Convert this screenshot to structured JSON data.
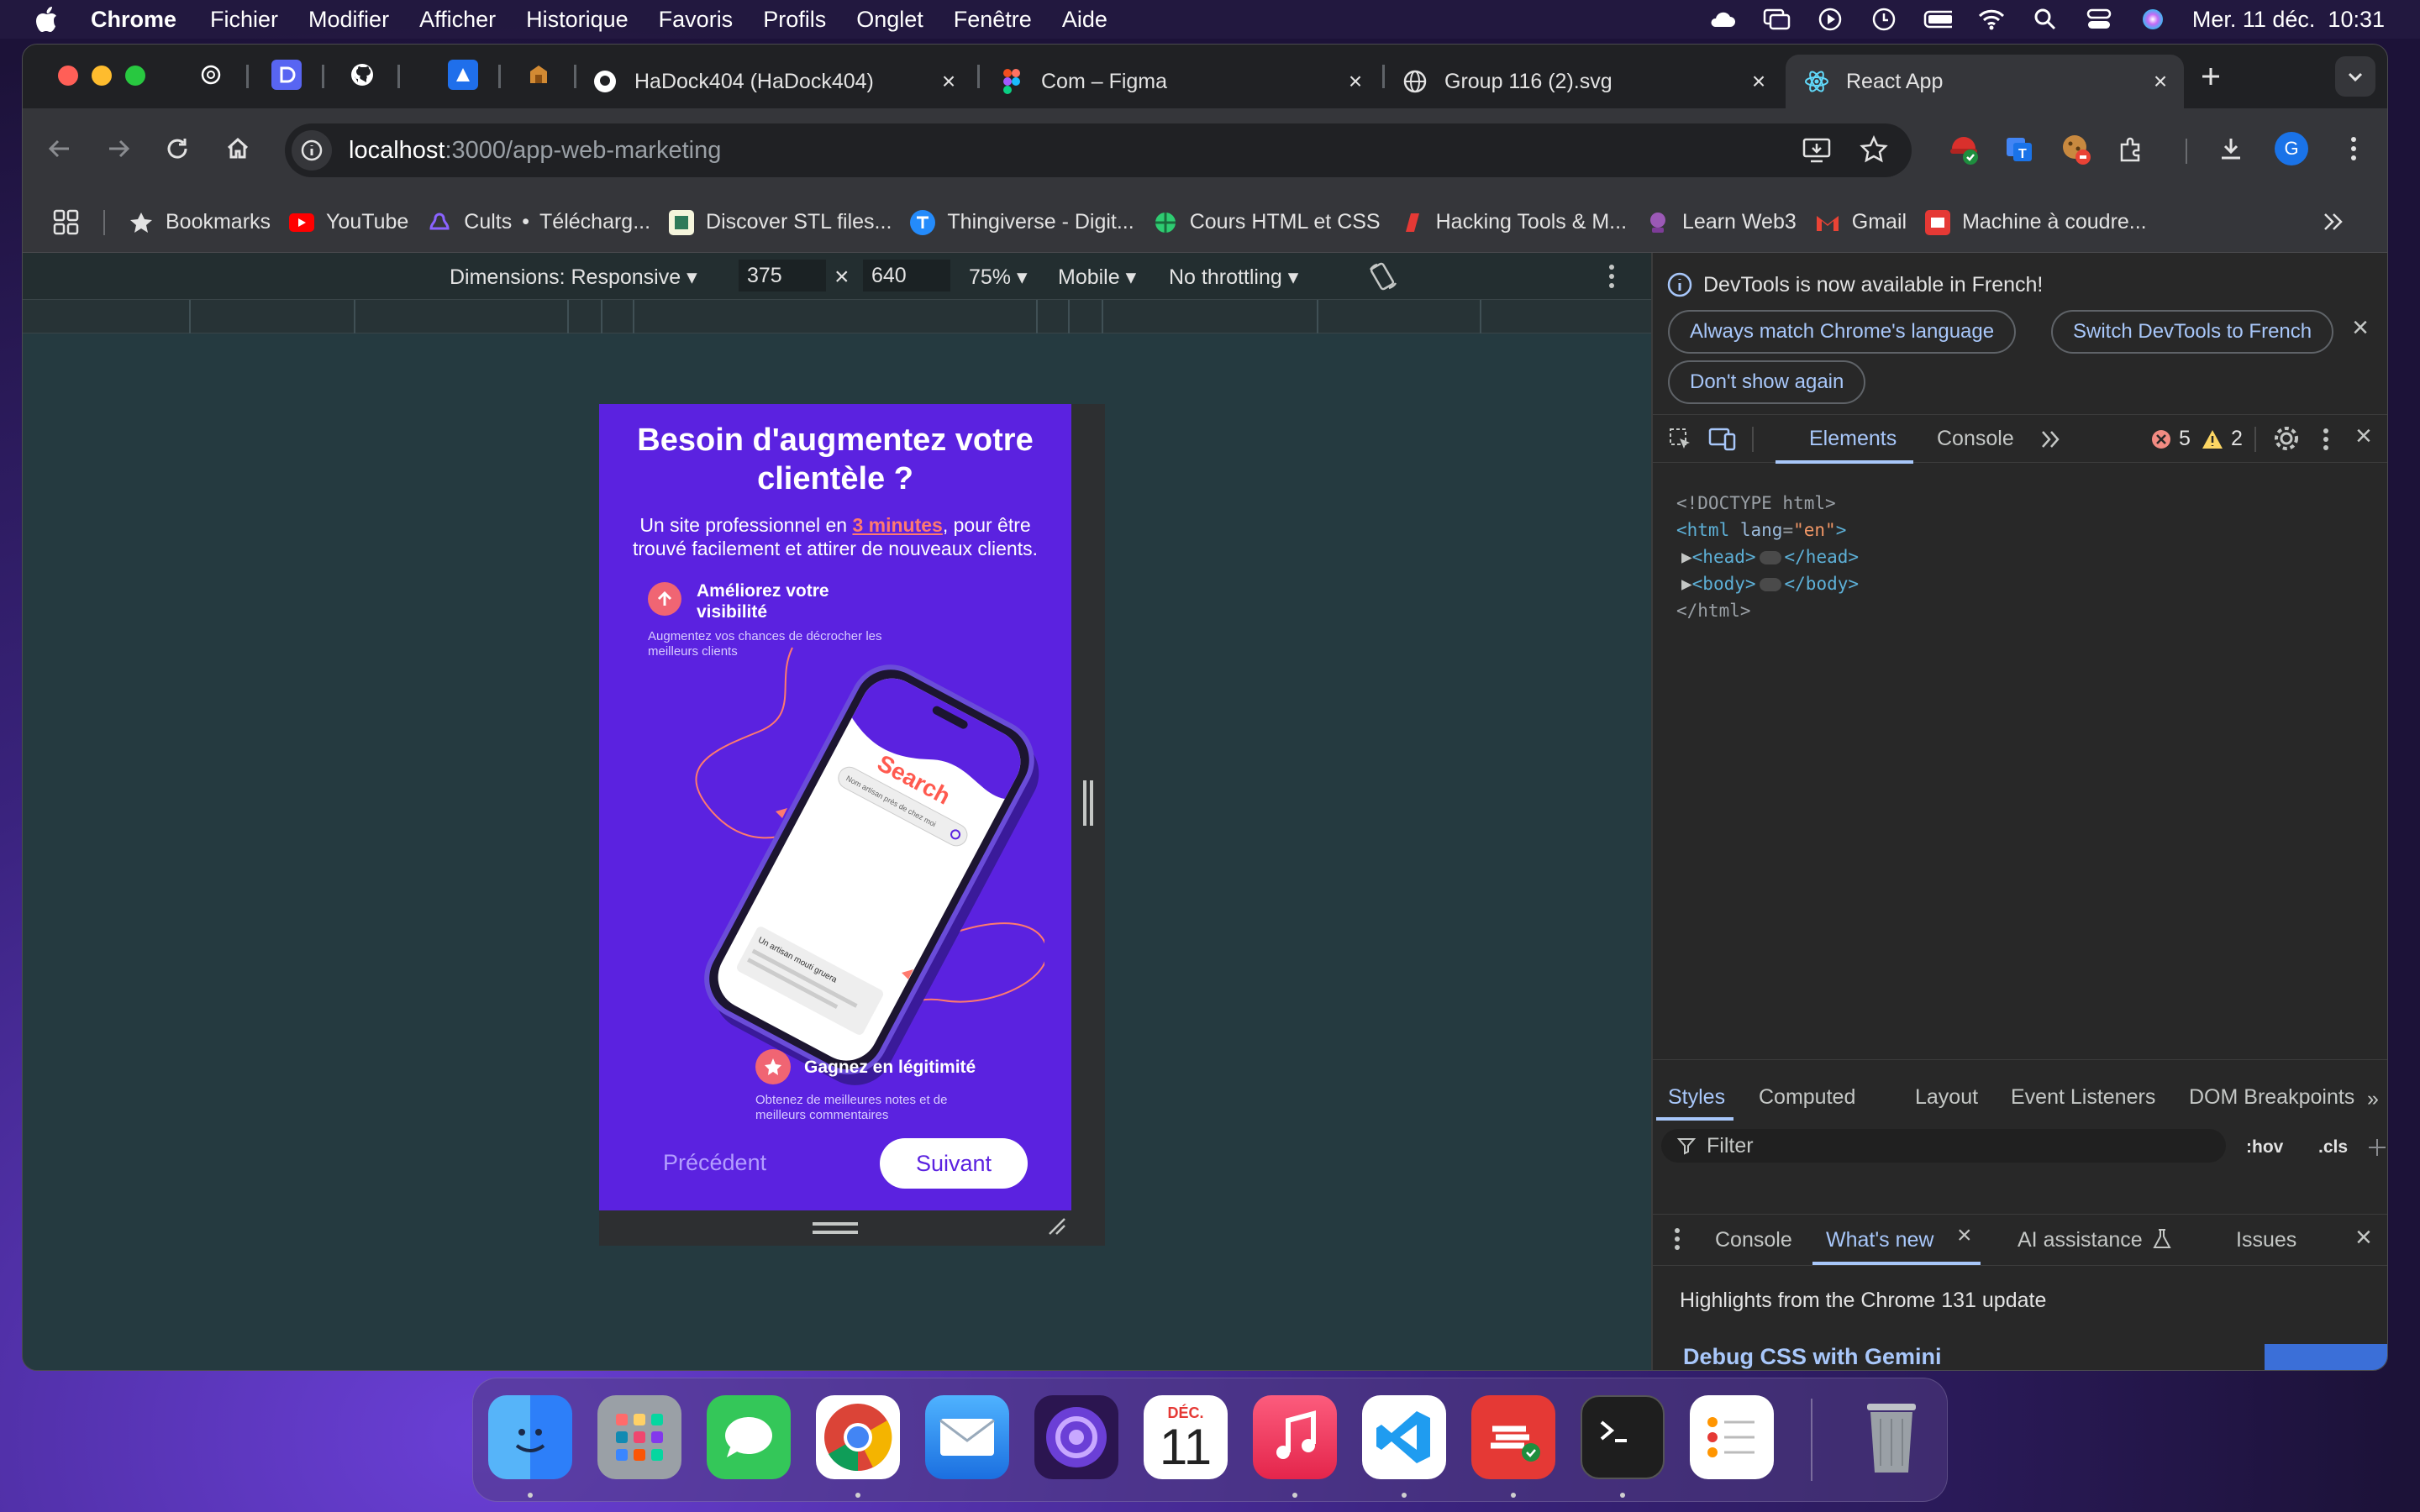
{
  "menubar": {
    "app": "Chrome",
    "items": [
      "Fichier",
      "Modifier",
      "Afficher",
      "Historique",
      "Favoris",
      "Profils",
      "Onglet",
      "Fenêtre",
      "Aide"
    ],
    "datetime": "Mer. 11 déc.  10:31"
  },
  "tabs": [
    {
      "label": "HaDock404 (HaDock404)",
      "icon": "github-icon"
    },
    {
      "label": "Com – Figma",
      "icon": "figma-icon"
    },
    {
      "label": "Group 116 (2).svg",
      "icon": "globe-icon"
    },
    {
      "label": "React App",
      "icon": "react-icon",
      "active": true
    }
  ],
  "omnibox": {
    "host": "localhost",
    "path": ":3000/app-web-marketing"
  },
  "bookmarks": [
    "Bookmarks",
    "YouTube",
    "Cults",
    "•",
    "Télécharg...",
    "Discover STL files...",
    "Thingiverse - Digit...",
    "Cours HTML et CSS",
    "Hacking Tools & M...",
    "Learn Web3",
    "Gmail",
    "Machine à coudre..."
  ],
  "devicebar": {
    "dimensions": "Dimensions: Responsive",
    "width": "375",
    "times": "×",
    "height": "640",
    "zoom": "75%",
    "device": "Mobile",
    "throttling": "No throttling"
  },
  "app": {
    "title": "Besoin d'augmentez votre clientèle ?",
    "subtitle_pre": "Un site professionnel en ",
    "subtitle_highlight": "3 minutes",
    "subtitle_post": ", pour être trouvé facilement et attirer de nouveaux clients.",
    "feature1_title": "Améliorez votre visibilité",
    "feature1_desc": "Augmentez vos chances de décrocher les meilleurs clients",
    "search_word": "Search",
    "search_placeholder": "Nom artisan près de chez moi",
    "result_text": "Un artisan mouti gruera",
    "feature2_title": "Gagnez en légitimité",
    "feature2_desc": "Obtenez de meilleures notes et de meilleurs commentaires",
    "prev_label": "Précédent",
    "next_label": "Suivant",
    "colors": {
      "bg": "#5b22e0",
      "accent": "#ff6b5b",
      "link": "#ff7a6e"
    }
  },
  "devtools": {
    "banner": "DevTools is now available in French!",
    "btn_match": "Always match Chrome's language",
    "btn_switch": "Switch DevTools to French",
    "btn_dont": "Don't show again",
    "tab_elements": "Elements",
    "tab_console": "Console",
    "errors": "5",
    "warnings": "2",
    "code": {
      "doctype": "<!DOCTYPE html>",
      "html_open": "<html",
      "lang_attr": "lang",
      "lang_val": "\"en\"",
      "gt": ">",
      "head": "<head>",
      "head_close": "</head>",
      "body": "<body>",
      "body_close": "</body>",
      "html_close": "</html>"
    },
    "styles_tabs": [
      "Styles",
      "Computed",
      "Layout",
      "Event Listeners",
      "DOM Breakpoints"
    ],
    "filter_placeholder": "Filter",
    "hov": ":hov",
    "cls": ".cls",
    "drawer_tabs": {
      "console": "Console",
      "whatsnew": "What's new",
      "ai": "AI assistance",
      "issues": "Issues"
    },
    "highlights": "Highlights from the Chrome 131 update",
    "debug_title": "Debug CSS with Gemini"
  },
  "dock": {
    "calendar_month": "DÉC.",
    "calendar_day": "11"
  }
}
